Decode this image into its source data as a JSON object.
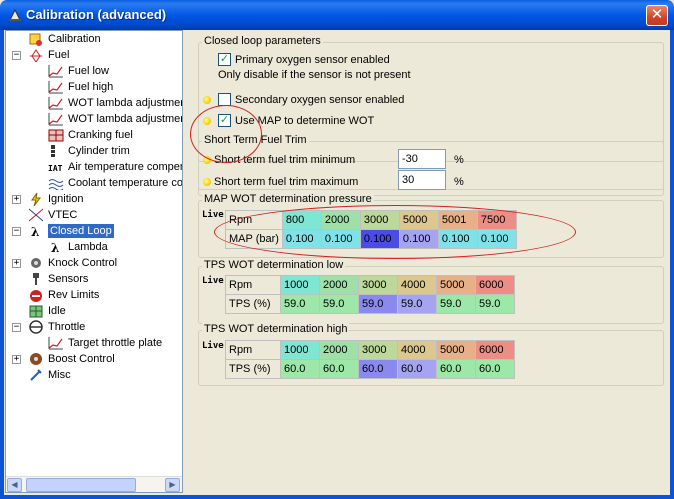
{
  "window": {
    "title": "Calibration (advanced)",
    "close_glyph": "✕"
  },
  "tree": [
    {
      "label": "Calibration",
      "icon": "calibration-icon",
      "level": 1,
      "expander": ""
    },
    {
      "label": "Fuel",
      "icon": "fuel-icon",
      "level": 1,
      "expander": "−"
    },
    {
      "label": "Fuel low",
      "icon": "graph-icon",
      "level": 2,
      "expander": ""
    },
    {
      "label": "Fuel high",
      "icon": "graph-icon",
      "level": 2,
      "expander": ""
    },
    {
      "label": "WOT lambda adjustmen",
      "icon": "graph-icon",
      "level": 2,
      "expander": ""
    },
    {
      "label": "WOT lambda adjustmen",
      "icon": "graph-icon",
      "level": 2,
      "expander": ""
    },
    {
      "label": "Cranking fuel",
      "icon": "table-icon",
      "level": 2,
      "expander": ""
    },
    {
      "label": "Cylinder trim",
      "icon": "cylinder-icon",
      "level": 2,
      "expander": ""
    },
    {
      "label": "Air temperature compens",
      "icon": "iat-icon",
      "level": 2,
      "expander": ""
    },
    {
      "label": "Coolant temperature cor",
      "icon": "coolant-icon",
      "level": 2,
      "expander": ""
    },
    {
      "label": "Ignition",
      "icon": "lightning-icon",
      "level": 1,
      "expander": "+"
    },
    {
      "label": "VTEC",
      "icon": "vtec-icon",
      "level": 1,
      "expander": ""
    },
    {
      "label": "Closed Loop",
      "icon": "lambda-icon",
      "level": 1,
      "expander": "−",
      "selected": true
    },
    {
      "label": "Lambda",
      "icon": "lambda-icon",
      "level": 2,
      "expander": ""
    },
    {
      "label": "Knock Control",
      "icon": "knock-icon",
      "level": 1,
      "expander": "+"
    },
    {
      "label": "Sensors",
      "icon": "sensor-icon",
      "level": 1,
      "expander": ""
    },
    {
      "label": "Rev Limits",
      "icon": "rev-limit-icon",
      "level": 1,
      "expander": ""
    },
    {
      "label": "Idle",
      "icon": "idle-icon",
      "level": 1,
      "expander": ""
    },
    {
      "label": "Throttle",
      "icon": "throttle-icon",
      "level": 1,
      "expander": "−"
    },
    {
      "label": "Target throttle plate",
      "icon": "graph-icon",
      "level": 2,
      "expander": ""
    },
    {
      "label": "Boost Control",
      "icon": "boost-icon",
      "level": 1,
      "expander": "+"
    },
    {
      "label": "Misc",
      "icon": "misc-icon",
      "level": 1,
      "expander": ""
    }
  ],
  "closed_loop": {
    "title": "Closed loop parameters",
    "primary_label": "Primary oxygen sensor enabled",
    "primary_checked": "✓",
    "primary_note": "Only disable if the sensor is not present",
    "secondary_label": "Secondary oxygen sensor enabled",
    "secondary_checked": "",
    "map_wot_label": "Use MAP to determine WOT",
    "map_wot_checked": "✓"
  },
  "fuel_trim": {
    "title": "Short Term Fuel Trim",
    "min_label": "Short term fuel trim minimum",
    "min_value": "-30",
    "min_unit": "%",
    "max_label": "Short term fuel trim maximum",
    "max_value": "30",
    "max_unit": "%"
  },
  "map_wot": {
    "title": "MAP WOT determination pressure",
    "live": "Live",
    "row1_label": "Rpm",
    "row2_label": "MAP (bar)",
    "rpm": [
      "800",
      "2000",
      "3000",
      "5000",
      "5001",
      "7500"
    ],
    "values": [
      "0.100",
      "0.100",
      "0.100",
      "0.100",
      "0.100",
      "0.100"
    ]
  },
  "tps_low": {
    "title": "TPS WOT determination low",
    "live": "Live",
    "row1_label": "Rpm",
    "row2_label": "TPS (%)",
    "rpm": [
      "1000",
      "2000",
      "3000",
      "4000",
      "5000",
      "6000"
    ],
    "values": [
      "59.0",
      "59.0",
      "59.0",
      "59.0",
      "59.0",
      "59.0"
    ]
  },
  "tps_high": {
    "title": "TPS WOT determination high",
    "live": "Live",
    "row1_label": "Rpm",
    "row2_label": "TPS (%)",
    "rpm": [
      "1000",
      "2000",
      "3000",
      "4000",
      "5000",
      "6000"
    ],
    "values": [
      "60.0",
      "60.0",
      "60.0",
      "60.0",
      "60.0",
      "60.0"
    ]
  },
  "colors": {
    "rpm_cells": [
      "#7fe6d4",
      "#9fe0a8",
      "#bcd89a",
      "#dcc78e",
      "#e8b089",
      "#ec8d86"
    ],
    "value_cells": [
      "#7fe2e8",
      "#7fe2e8",
      "#5a5ae6",
      "#a4a4f0",
      "#7fe2e8",
      "#7fe2e8"
    ],
    "map_value_cells": [
      "#7fe2e8",
      "#7fe2e8",
      "#4b4be8",
      "#a4a4f0",
      "#7fe2e8",
      "#7fe2e8"
    ],
    "tps_value_cells": [
      "#9de8a8",
      "#9de8a8",
      "#8a8aee",
      "#a4a4f0",
      "#9de8a8",
      "#9de8a8"
    ],
    "selection": "#316ac5",
    "annotation": "#d42020"
  }
}
